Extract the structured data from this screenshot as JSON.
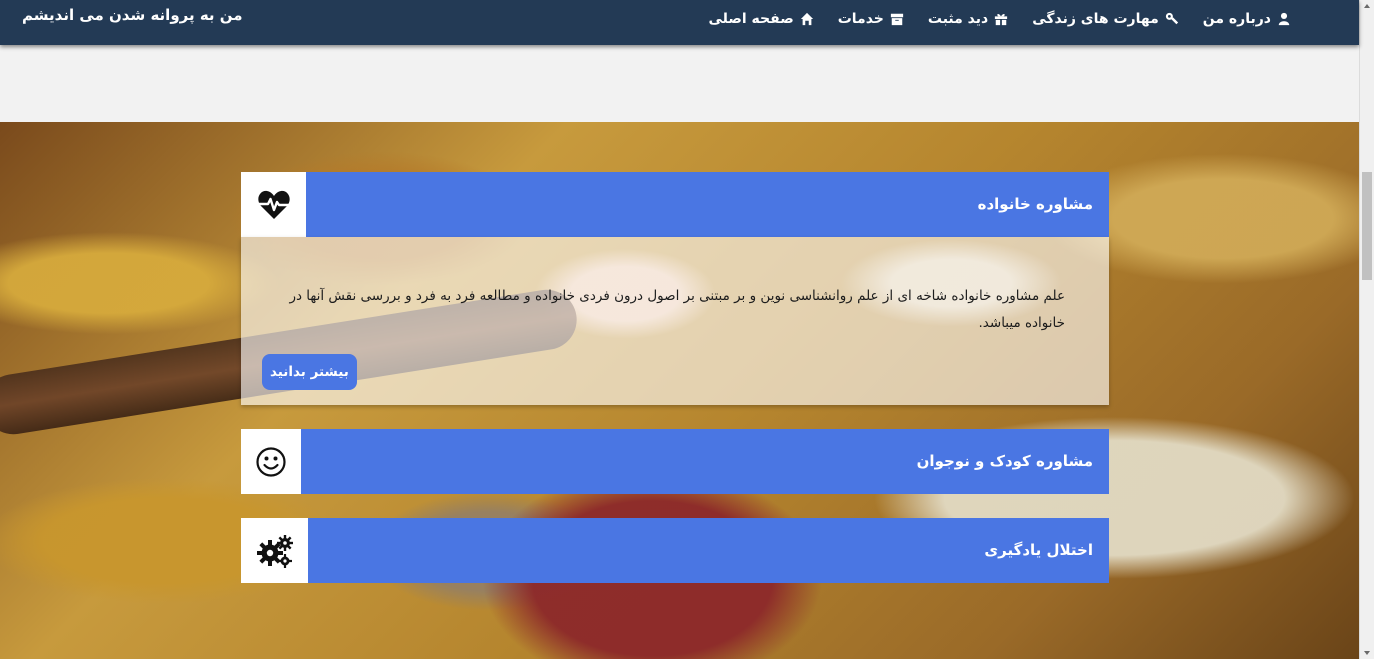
{
  "brand": "من به پروانه شدن می اندیشم",
  "nav": [
    {
      "label": "صفحه اصلی",
      "icon": "home-icon"
    },
    {
      "label": "خدمات",
      "icon": "archive-icon"
    },
    {
      "label": "دید مثبت",
      "icon": "gift-icon"
    },
    {
      "label": "مهارت های زندگی",
      "icon": "wrench-icon"
    },
    {
      "label": "درباره من",
      "icon": "user-icon"
    }
  ],
  "cards": [
    {
      "title": "مشاوره خانواده",
      "icon": "heartbeat-icon",
      "text": "علم مشاوره خانواده شاخه ای از علم روانشناسی نوین و بر مبتنی بر اصول درون فردی خانواده و مطالعه فرد به فرد و بررسی نقش آنها در خانواده میباشد.",
      "button": "بیشتر بدانید"
    },
    {
      "title": "مشاوره کودک و نوجوان",
      "icon": "smiley-icon"
    },
    {
      "title": "اختلال یادگیری",
      "icon": "gears-icon"
    }
  ],
  "colors": {
    "navbar": "#233a55",
    "accent": "#4a76e3"
  }
}
